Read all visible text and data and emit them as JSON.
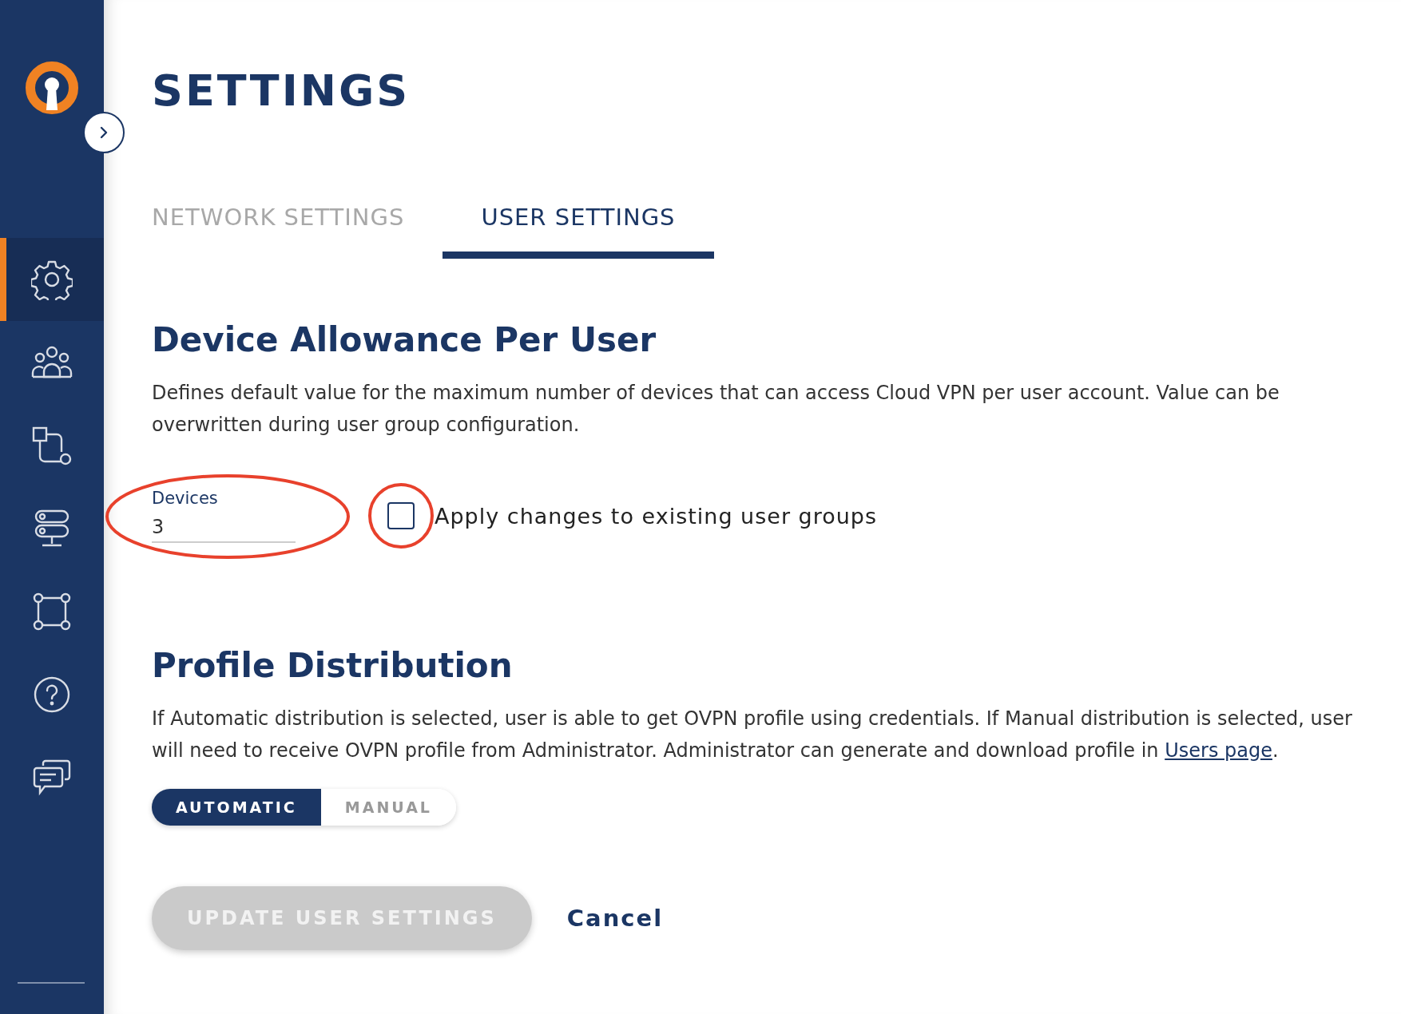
{
  "sidebar": {
    "items": [
      {
        "kind": "settings",
        "selected": true
      },
      {
        "kind": "users",
        "selected": false
      },
      {
        "kind": "flow",
        "selected": false
      },
      {
        "kind": "servers",
        "selected": false
      },
      {
        "kind": "network",
        "selected": false
      },
      {
        "kind": "help",
        "selected": false
      },
      {
        "kind": "chat",
        "selected": false
      }
    ]
  },
  "page_title": "SETTINGS",
  "tabs": [
    {
      "label": "NETWORK SETTINGS",
      "selected": false
    },
    {
      "label": "USER SETTINGS",
      "selected": true
    }
  ],
  "device_section": {
    "heading": "Device Allowance Per User",
    "description": "Defines default value for the maximum number of devices that can access Cloud VPN per user account. Value can be overwritten during user group configuration.",
    "devices_field": {
      "label": "Devices",
      "value": "3"
    },
    "apply_checkbox": {
      "label": "Apply changes to existing user groups",
      "checked": false
    }
  },
  "profile_section": {
    "heading": "Profile Distribution",
    "description_before": "If Automatic distribution is selected, user is able to get OVPN profile using credentials. If Manual distribution is selected, user will need to receive OVPN profile from Administrator. Administrator can generate and download profile in ",
    "link": "Users page",
    "description_after": ".",
    "options": [
      {
        "label": "AUTOMATIC",
        "selected": true
      },
      {
        "label": "MANUAL",
        "selected": false
      }
    ]
  },
  "update_button": {
    "label": "UPDATE USER SETTINGS",
    "disabled": true
  },
  "cancel_button": {
    "label": "Cancel"
  }
}
